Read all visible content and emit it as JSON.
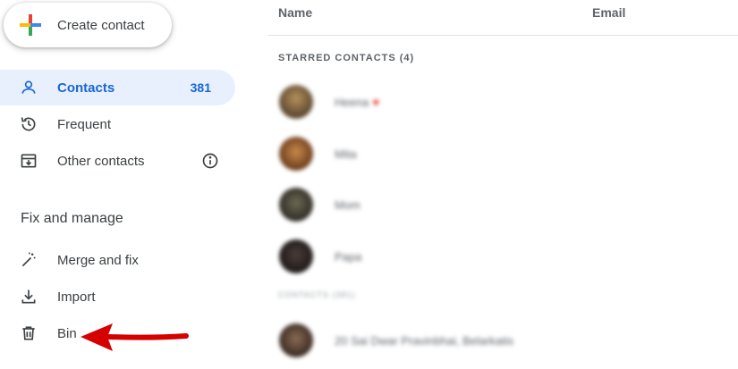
{
  "sidebar": {
    "create_label": "Create contact",
    "items": [
      {
        "label": "Contacts",
        "count": "381",
        "icon": "person-icon"
      },
      {
        "label": "Frequent",
        "icon": "history-icon"
      },
      {
        "label": "Other contacts",
        "icon": "archive-download-icon",
        "info_icon": "info-icon"
      }
    ],
    "section_title": "Fix and manage",
    "manage_items": [
      {
        "label": "Merge and fix",
        "icon": "magic-wand-icon"
      },
      {
        "label": "Import",
        "icon": "download-icon"
      },
      {
        "label": "Bin",
        "icon": "trash-icon"
      }
    ]
  },
  "list": {
    "col_name": "Name",
    "col_email": "Email",
    "starred_title": "STARRED CONTACTS (4)",
    "starred": [
      {
        "name": "Heena",
        "heart": "♥"
      },
      {
        "name": "Mita"
      },
      {
        "name": "Mom"
      },
      {
        "name": "Papa"
      }
    ],
    "contacts_title": "CONTACTS (381)",
    "contacts": [
      {
        "name": "20 Sai Dwar Pravinbhai, Belarkatis"
      }
    ]
  },
  "colors": {
    "accent": "#1967d2",
    "active_bg": "#e8f0fe",
    "annotation_arrow": "#d50000"
  }
}
